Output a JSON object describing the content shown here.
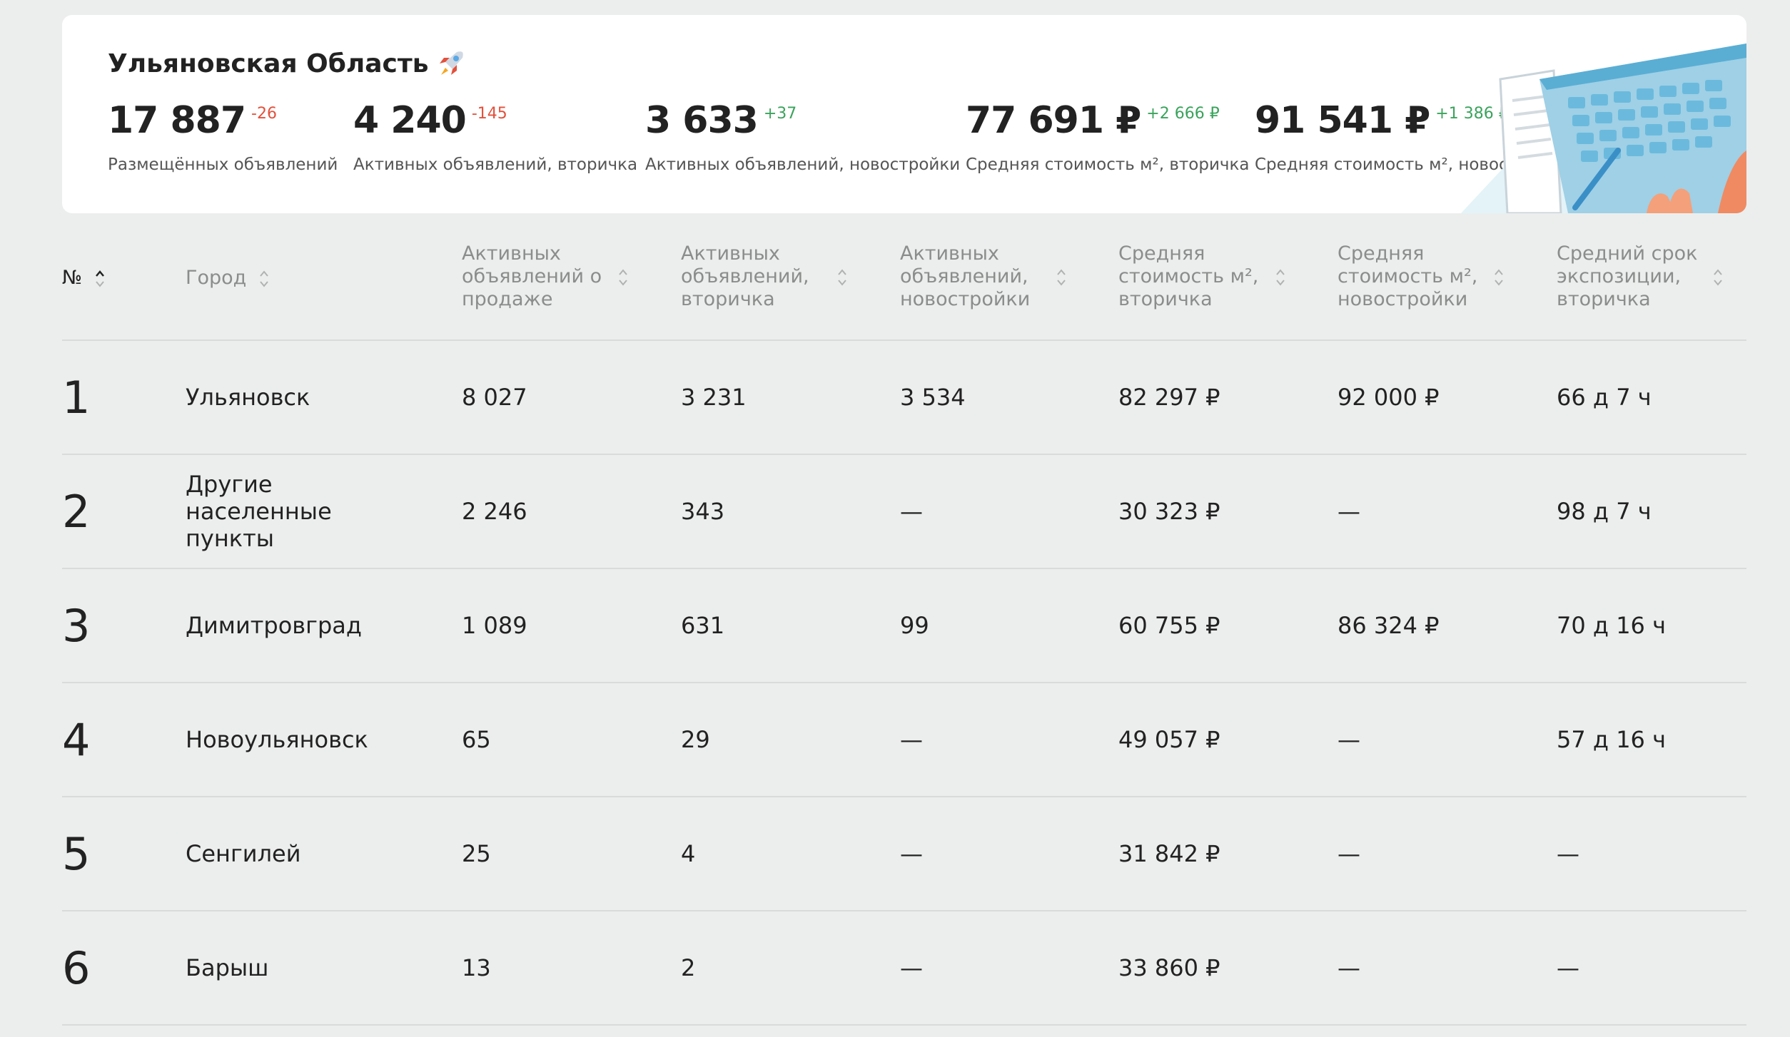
{
  "summary": {
    "region_title": "Ульяновская Область",
    "stats": [
      {
        "value": "17 887",
        "delta": "-26",
        "label": "Размещённых объявлений",
        "trend": "negative"
      },
      {
        "value": "4 240",
        "delta": "-145",
        "label": "Активных объявлений, вторичка",
        "trend": "negative"
      },
      {
        "value": "3 633",
        "delta": "+37",
        "label": "Активных объявлений, новостройки",
        "trend": "positive"
      },
      {
        "value": "77 691 ₽",
        "delta": "+2 666 ₽",
        "label": "Средняя стоимость м², вторичка",
        "trend": "positive"
      },
      {
        "value": "91 541 ₽",
        "delta": "+1 386 ₽",
        "label": "Средняя стоимость м², новостройки",
        "trend": "positive"
      }
    ]
  },
  "colors": {
    "negative": "#e2513c",
    "positive": "#3aa35c",
    "background": "#eceeed",
    "header_text": "#8b8d8c"
  },
  "table": {
    "headers": [
      {
        "label": "№"
      },
      {
        "label": "Город"
      },
      {
        "label": "Активных объявлений о продаже"
      },
      {
        "label": "Активных объявлений, вторичка"
      },
      {
        "label": "Активных объявлений, новостройки"
      },
      {
        "label": "Средняя стоимость м², вторичка"
      },
      {
        "label": "Средняя стоимость м², новостройки"
      },
      {
        "label": "Средний срок экспозиции, вторичка"
      }
    ],
    "rows": [
      {
        "num": "1",
        "city": "Ульяновск",
        "total": "8 027",
        "secondary": "3 231",
        "new": "3 534",
        "price_secondary": "82 297 ₽",
        "price_new": "92 000 ₽",
        "exposure": "66 д 7 ч"
      },
      {
        "num": "2",
        "city": "Другие населенные пункты",
        "total": "2 246",
        "secondary": "343",
        "new": "—",
        "price_secondary": "30 323 ₽",
        "price_new": "—",
        "exposure": "98 д 7 ч"
      },
      {
        "num": "3",
        "city": "Димитровград",
        "total": "1 089",
        "secondary": "631",
        "new": "99",
        "price_secondary": "60 755 ₽",
        "price_new": "86 324 ₽",
        "exposure": "70 д 16 ч"
      },
      {
        "num": "4",
        "city": "Новоульяновск",
        "total": "65",
        "secondary": "29",
        "new": "—",
        "price_secondary": "49 057 ₽",
        "price_new": "—",
        "exposure": "57 д 16 ч"
      },
      {
        "num": "5",
        "city": "Сенгилей",
        "total": "25",
        "secondary": "4",
        "new": "—",
        "price_secondary": "31 842 ₽",
        "price_new": "—",
        "exposure": "—"
      },
      {
        "num": "6",
        "city": "Барыш",
        "total": "13",
        "secondary": "2",
        "new": "—",
        "price_secondary": "33 860 ₽",
        "price_new": "—",
        "exposure": "—"
      }
    ]
  },
  "icons": {
    "title_icon": "rocket-icon",
    "sort_icon": "sort-arrows-icon",
    "illustration": "laptop-illustration"
  }
}
